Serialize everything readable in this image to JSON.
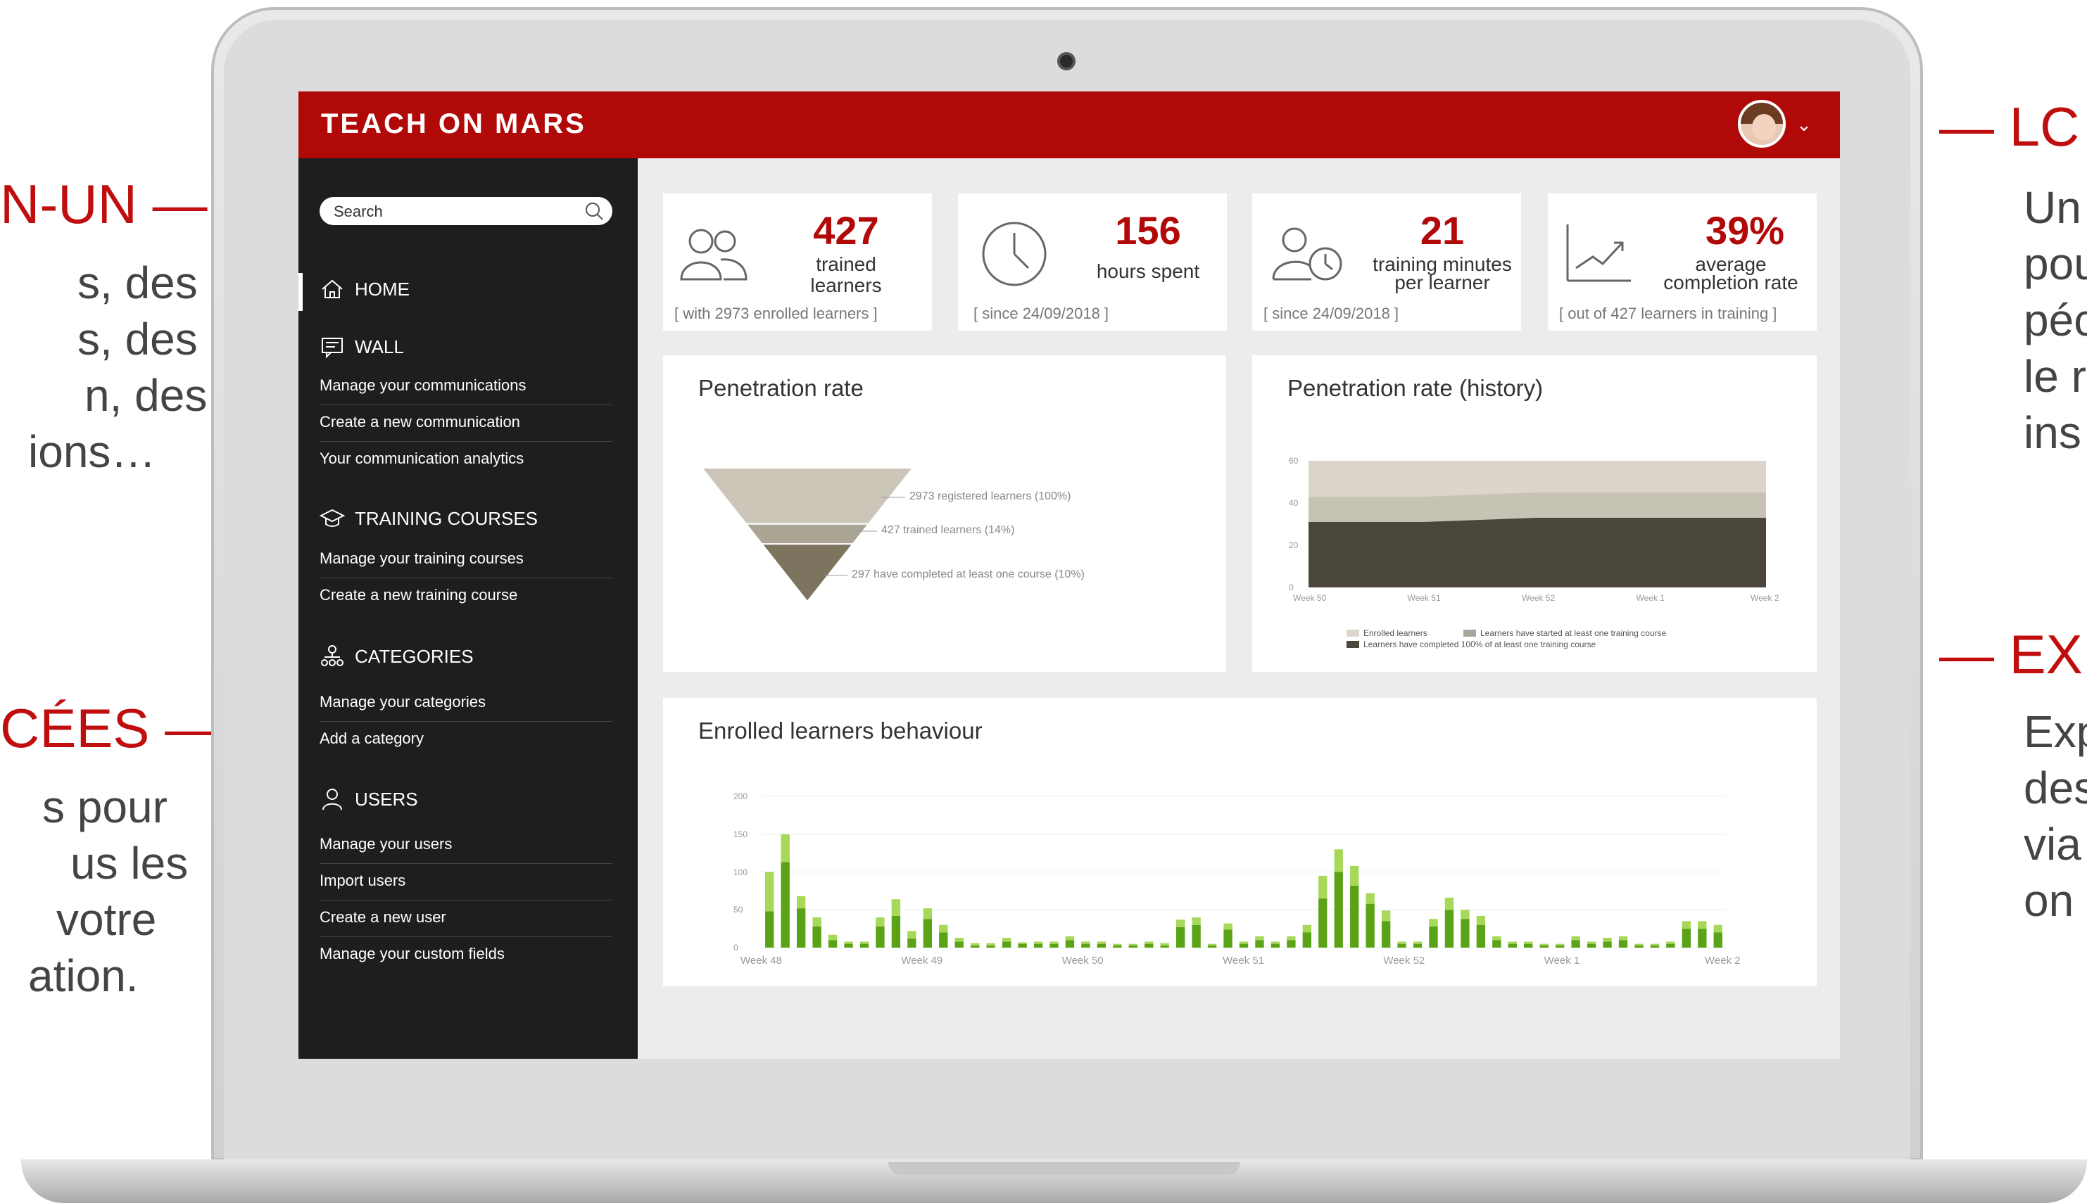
{
  "annotations": {
    "left1_title": "N-UN —",
    "left1_lines": [
      "s, des",
      "s, des",
      "n, des",
      "ions…"
    ],
    "left2_title": "CÉES —",
    "left2_lines": [
      "s pour",
      "us les",
      " votre",
      "ation."
    ],
    "right1_title": "— LC",
    "right1_lines": [
      "Un",
      "pou",
      "péc",
      "le r",
      "ins"
    ],
    "right2_title": "— EX",
    "right2_lines": [
      "Exp",
      "des",
      "via",
      "on"
    ]
  },
  "app": {
    "logo": "TEACH ON MARS",
    "chevron": "⌄"
  },
  "sidebar": {
    "search_placeholder": "Search",
    "home": "HOME",
    "wall": "WALL",
    "wall_items": [
      "Manage your communications",
      "Create a new communication",
      "Your communication analytics"
    ],
    "training": "TRAINING COURSES",
    "training_items": [
      "Manage your training courses",
      "Create a new training course"
    ],
    "categories": "CATEGORIES",
    "categories_items": [
      "Manage your categories",
      "Add a category"
    ],
    "users": "USERS",
    "users_items": [
      "Manage your users",
      "Import users",
      "Create a new user",
      "Manage your custom fields"
    ]
  },
  "kpis": [
    {
      "value": "427",
      "label1": "trained",
      "label2": "learners",
      "foot": "[ with 2973 enrolled learners ]",
      "icon": "users-icon"
    },
    {
      "value": "156",
      "label1": "hours spent",
      "label2": "",
      "foot": "[ since 24/09/2018 ]",
      "icon": "clock-icon"
    },
    {
      "value": "21",
      "label1": "training minutes",
      "label2": "per learner",
      "foot": "[ since 24/09/2018 ]",
      "icon": "user-clock-icon"
    },
    {
      "value": "39%",
      "label1": "average",
      "label2": "completion rate",
      "foot": "[ out of 427 learners in training ]",
      "icon": "chart-line-icon"
    }
  ],
  "colors": {
    "brand": "#b10808",
    "sidebar": "#1e1e1e",
    "bar_dark": "#5aa316",
    "bar_light": "#a8d85a",
    "area1": "#dcd6ca",
    "area2": "#c6c2b4",
    "area3": "#4a463c"
  },
  "chart_data": [
    {
      "type": "funnel",
      "title": "Penetration rate",
      "stages": [
        {
          "label": "2973 registered learners (100%)",
          "value": 2973
        },
        {
          "label": "427 trained learners (14%)",
          "value": 427
        },
        {
          "label": "297 have completed at least one course (10%)",
          "value": 297
        }
      ]
    },
    {
      "type": "area",
      "title": "Penetration rate (history)",
      "categories": [
        "Week 50",
        "Week 51",
        "Week 52",
        "Week 1",
        "Week 2"
      ],
      "yticks": [
        "0",
        "20",
        "40",
        "60"
      ],
      "ylim": [
        0,
        60
      ],
      "series": [
        {
          "name": "Enrolled learners",
          "values": [
            60,
            60,
            60,
            60,
            60
          ]
        },
        {
          "name": "Learners have started at least one training course",
          "values": [
            43,
            43,
            45,
            45,
            45
          ]
        },
        {
          "name": "Learners have completed 100% of at least one training course",
          "values": [
            31,
            31,
            33,
            33,
            33
          ]
        }
      ]
    },
    {
      "type": "bar",
      "title": "Enrolled learners behaviour",
      "xticks": [
        "Week 48",
        "Week 49",
        "Week 50",
        "Week 51",
        "Week 52",
        "Week 1",
        "Week 2"
      ],
      "yticks": [
        "0",
        "50",
        "100",
        "150",
        "200"
      ],
      "ylim": [
        0,
        200
      ],
      "series": [
        {
          "values": [
            48,
            113,
            52,
            28,
            10,
            5,
            5,
            28,
            42,
            12,
            38,
            20,
            8,
            3,
            3,
            8,
            5,
            5,
            5,
            10,
            5,
            5,
            3,
            3,
            5,
            3,
            27,
            30,
            3,
            24,
            5,
            10,
            5,
            10,
            20,
            65,
            100,
            82,
            58,
            35,
            5,
            5,
            28,
            50,
            38,
            30,
            10,
            5,
            5,
            3,
            3,
            10,
            5,
            8,
            10,
            3,
            3,
            5,
            25,
            25,
            20
          ]
        },
        {
          "values": [
            52,
            37,
            16,
            12,
            7,
            3,
            3,
            12,
            22,
            10,
            14,
            10,
            5,
            3,
            3,
            5,
            2,
            3,
            3,
            5,
            3,
            3,
            2,
            2,
            3,
            3,
            10,
            10,
            2,
            8,
            3,
            5,
            3,
            5,
            10,
            30,
            30,
            26,
            14,
            14,
            3,
            3,
            10,
            16,
            12,
            12,
            5,
            3,
            3,
            2,
            2,
            5,
            3,
            5,
            5,
            2,
            2,
            3,
            10,
            10,
            10
          ]
        }
      ]
    }
  ]
}
